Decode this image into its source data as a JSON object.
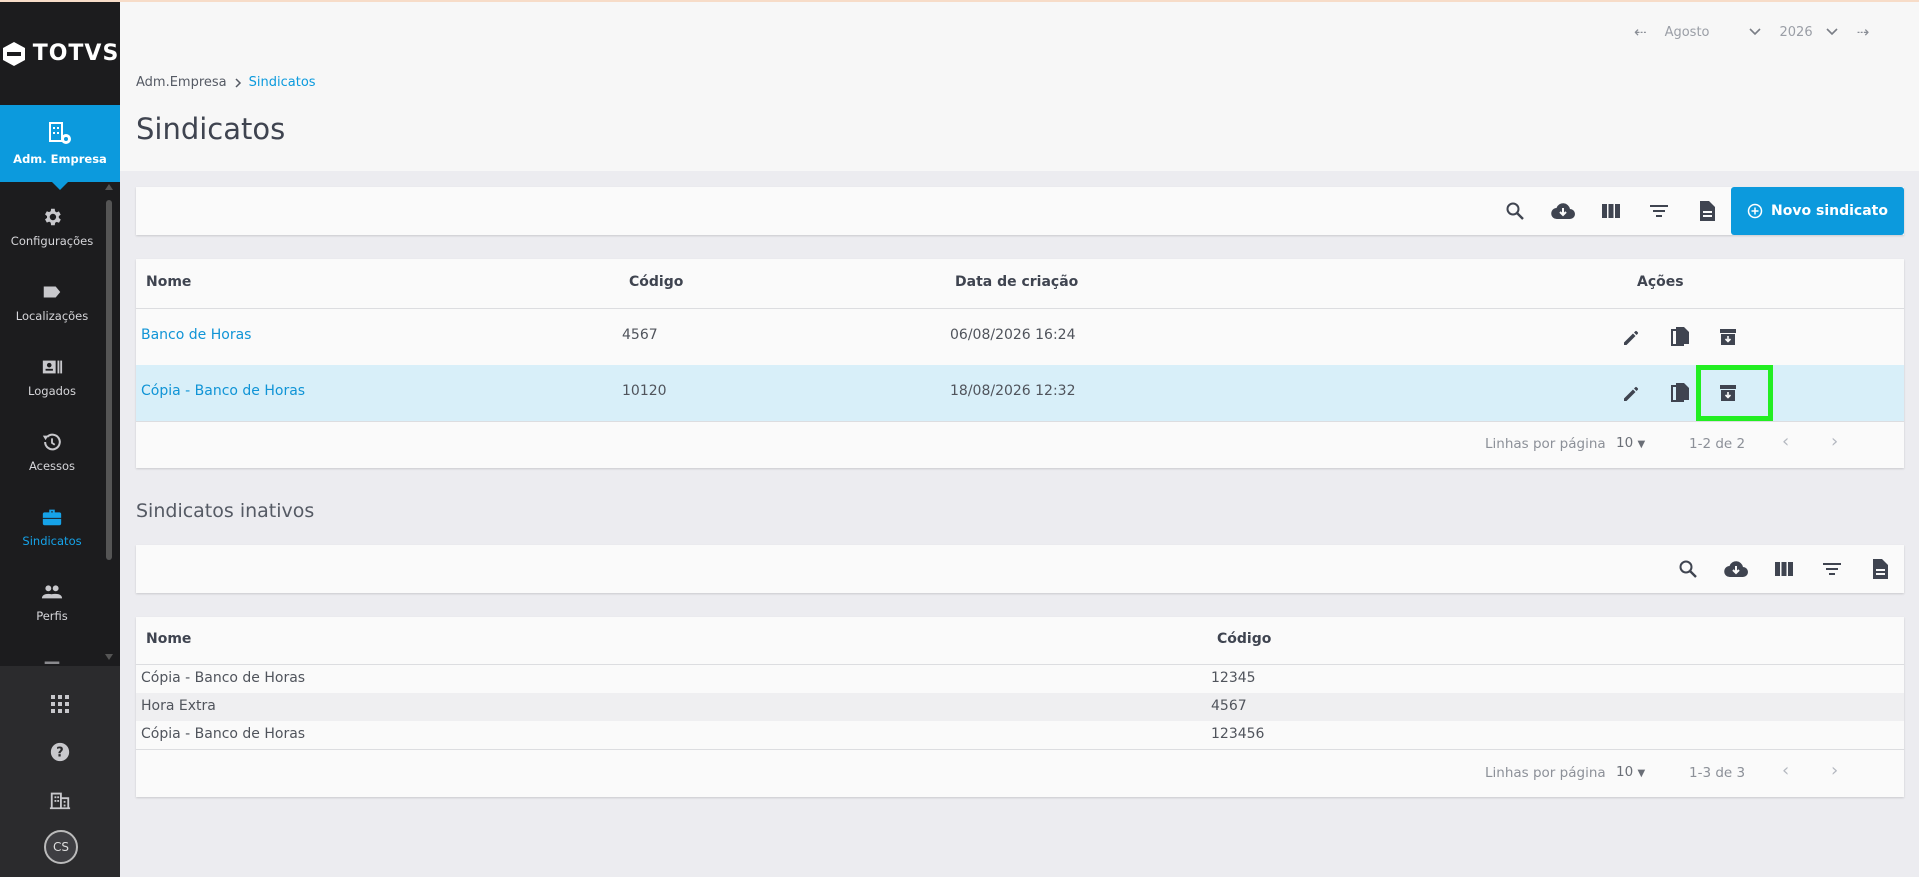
{
  "brand": {
    "name": "TOTVS"
  },
  "sidebar": {
    "active": {
      "label": "Adm. Empresa",
      "icon": "building-gear-icon"
    },
    "items": [
      {
        "label": "Configurações",
        "icon": "gear-icon"
      },
      {
        "label": "Localizações",
        "icon": "tag-icon"
      },
      {
        "label": "Logados",
        "icon": "badge-icon"
      },
      {
        "label": "Acessos",
        "icon": "history-icon"
      },
      {
        "label": "Sindicatos",
        "icon": "briefcase-icon",
        "current": true
      },
      {
        "label": "Perfis",
        "icon": "people-icon"
      }
    ],
    "bottom": {
      "avatar_initials": "CS"
    }
  },
  "period": {
    "month": "Agosto",
    "year": "2026"
  },
  "breadcrumb": {
    "parent": "Adm.Empresa",
    "current": "Sindicatos"
  },
  "page_title": "Sindicatos",
  "new_button": {
    "label": "Novo sindicato"
  },
  "active_table": {
    "columns": {
      "name": "Nome",
      "code": "Código",
      "created": "Data de criação",
      "actions": "Ações"
    },
    "rows": [
      {
        "name": "Banco de Horas",
        "code": "4567",
        "created": "06/08/2026 16:24"
      },
      {
        "name": "Cópia - Banco de Horas",
        "code": "10120",
        "created": "18/08/2026 12:32"
      }
    ],
    "pager": {
      "rows_label": "Linhas por página",
      "rows_value": "10",
      "range": "1-2 de 2"
    }
  },
  "inactive_section": {
    "title": "Sindicatos inativos"
  },
  "inactive_table": {
    "columns": {
      "name": "Nome",
      "code": "Código"
    },
    "rows": [
      {
        "name": "Cópia - Banco de Horas",
        "code": "12345"
      },
      {
        "name": "Hora Extra",
        "code": "4567"
      },
      {
        "name": "Cópia - Banco de Horas",
        "code": "123456"
      }
    ],
    "pager": {
      "rows_label": "Linhas por página",
      "rows_value": "10",
      "range": "1-3 de 3"
    }
  },
  "colors": {
    "accent": "#0c9add",
    "highlight": "#22ee22",
    "sidebar": "#1c1c1e",
    "selected_row": "#d8eff9"
  }
}
